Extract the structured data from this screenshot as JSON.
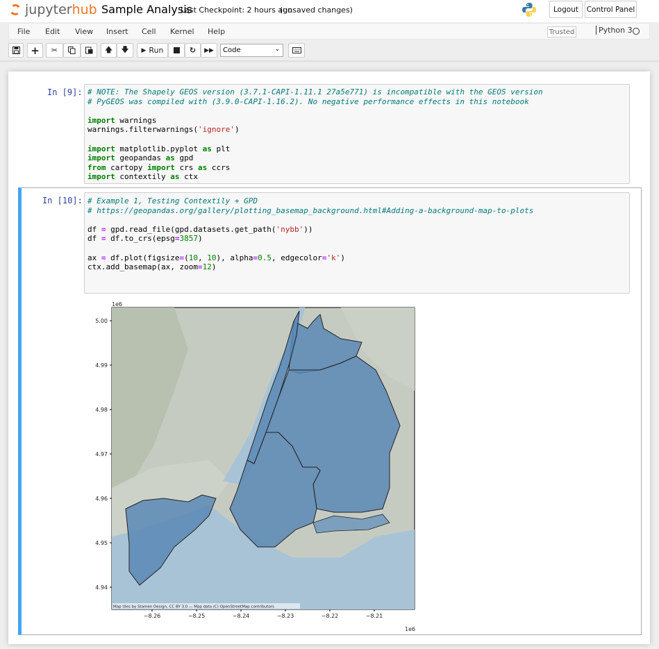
{
  "header": {
    "logo_part1": "jupyter",
    "logo_part2": "hub",
    "notebook_title": "Sample Analysis",
    "checkpoint": "Last Checkpoint: 2 hours ago",
    "save_status": "(unsaved changes)",
    "logout": "Logout",
    "control_panel": "Control Panel"
  },
  "menubar": {
    "items": [
      "File",
      "Edit",
      "View",
      "Insert",
      "Cell",
      "Kernel",
      "Help"
    ],
    "trusted": "Trusted",
    "kernel": "Python 3"
  },
  "toolbar": {
    "run_label": "Run",
    "cell_type": "Code"
  },
  "cells": [
    {
      "prompt": "In [9]:",
      "lines": [
        "# NOTE: The Shapely GEOS version (3.7.1-CAPI-1.11.1 27a5e771) is incompatible with the GEOS version",
        "# PyGEOS was compiled with (3.9.0-CAPI-1.16.2). No negative performance effects in this notebook",
        "",
        "import warnings",
        "warnings.filterwarnings('ignore')",
        "",
        "import matplotlib.pyplot as plt",
        "import geopandas as gpd",
        "from cartopy import crs as ccrs",
        "import contextily as ctx"
      ]
    },
    {
      "prompt": "In [10]:",
      "lines": [
        "# Example 1, Testing Contextily + GPD",
        "# https://geopandas.org/gallery/plotting_basemap_background.html#Adding-a-background-map-to-plots",
        "",
        "df = gpd.read_file(gpd.datasets.get_path('nybb'))",
        "df = df.to_crs(epsg=3857)",
        "",
        "ax = df.plot(figsize=(10, 10), alpha=0.5, edgecolor='k')",
        "ctx.add_basemap(ax, zoom=12)"
      ]
    }
  ],
  "figure": {
    "attribution": "Map tiles by Stamen Design, CC BY 3.0 — Map data (C) OpenStreetMap contributors",
    "y_exponent": "1e6",
    "x_exponent": "1e6",
    "y_ticks": [
      "5.00",
      "4.99",
      "4.98",
      "4.97",
      "4.96",
      "4.95",
      "4.94"
    ],
    "x_ticks": [
      "−8.26",
      "−8.25",
      "−8.24",
      "−8.23",
      "−8.22",
      "−8.21"
    ],
    "map_bg": "#c8cdc4",
    "water": "#a9c3d6",
    "boroughs": "#5a88b5"
  }
}
